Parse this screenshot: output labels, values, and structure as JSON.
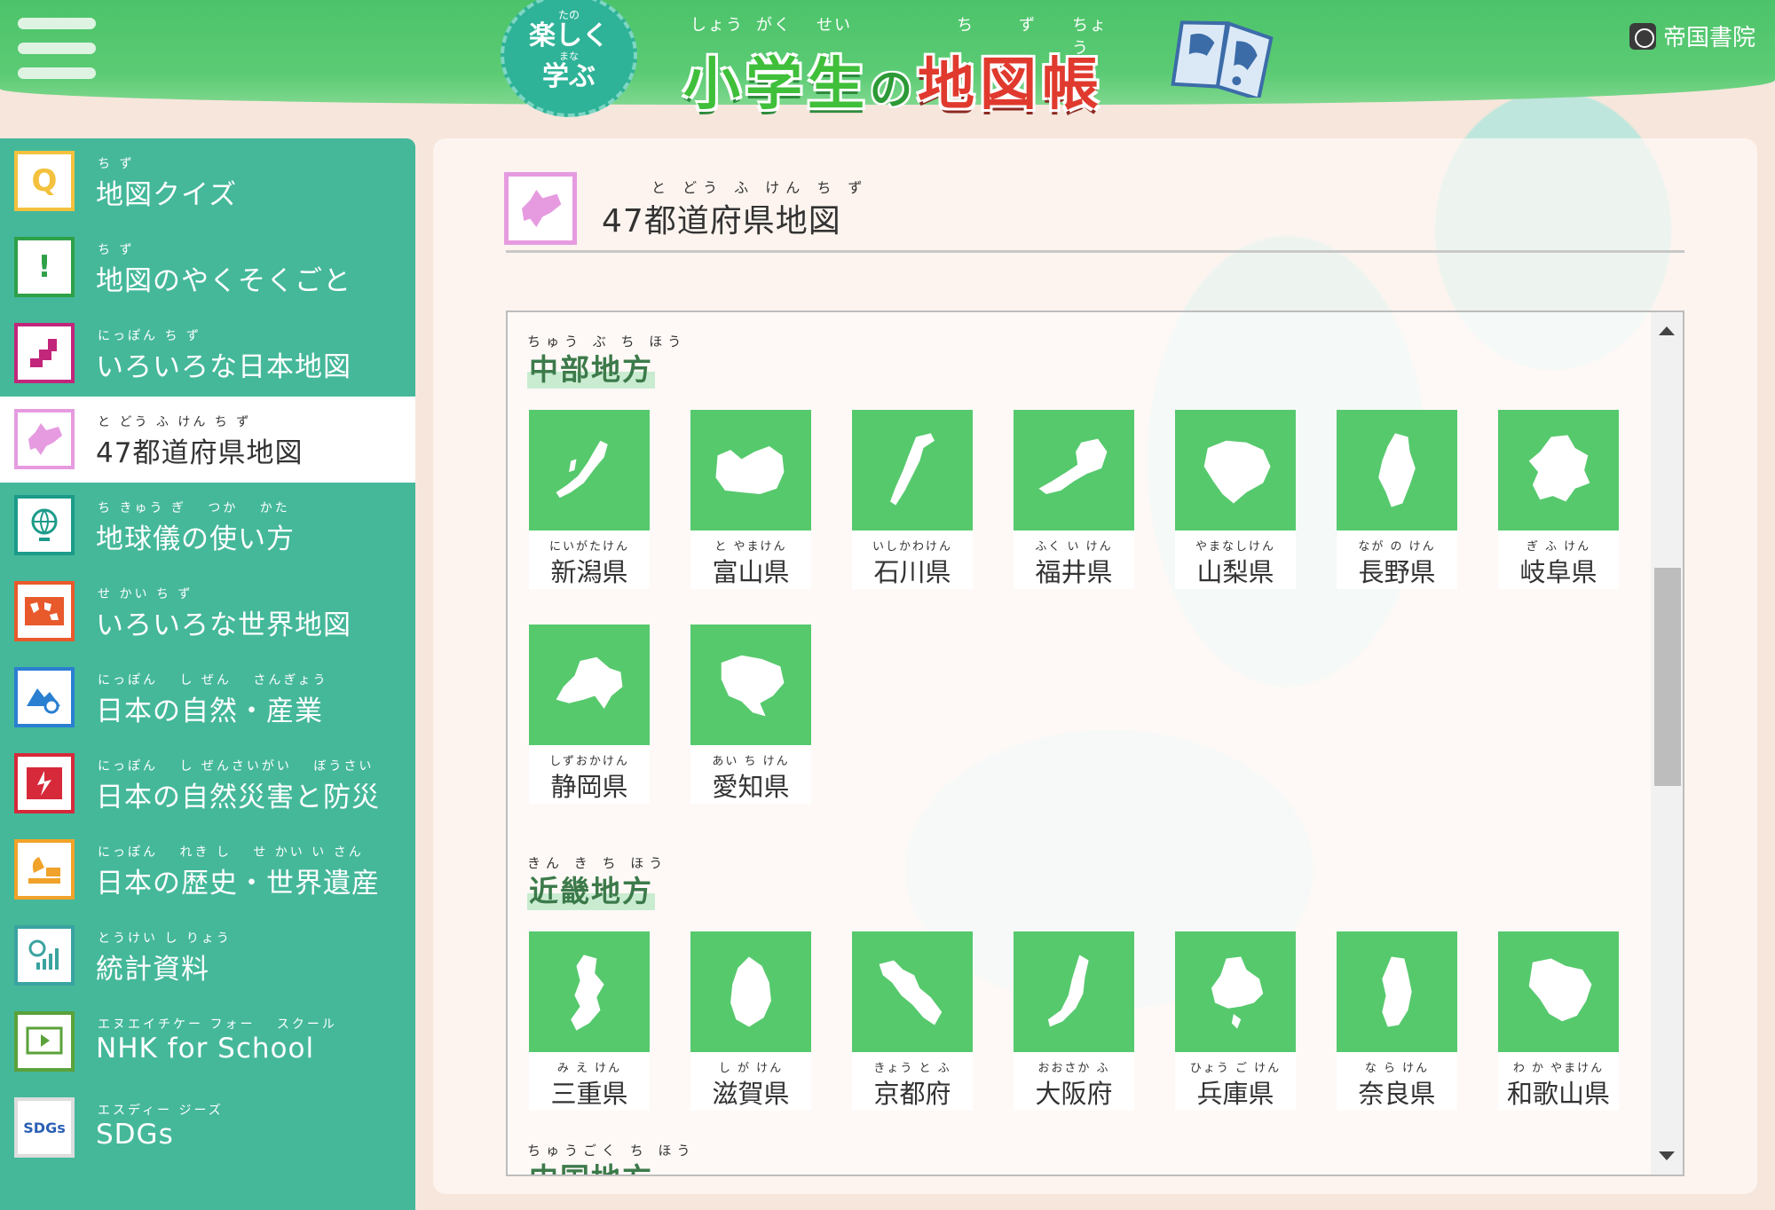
{
  "header": {
    "badge": {
      "ruby_top": "たの",
      "line1": "楽しく",
      "ruby_mid": "まな",
      "line2": "学ぶ"
    },
    "title": {
      "part1": "小学生",
      "part2": "の",
      "part3": "地図帳",
      "ruby": [
        "しょう",
        "がく",
        "せい",
        "ち",
        "ず",
        "ちょう"
      ]
    },
    "publisher": "帝国書院"
  },
  "sidebar": {
    "items": [
      {
        "icon": "Q",
        "icon_color": "#f3c13d",
        "ruby": "ち ず",
        "label": "地図クイズ",
        "active": false
      },
      {
        "icon": "!",
        "icon_color": "#2da048",
        "ruby": "ち ず",
        "label": "地図のやくそくごと",
        "active": false
      },
      {
        "icon": "",
        "icon_color": "#c2267a",
        "ruby": "にっぽん ち ず",
        "label": "いろいろな日本地図",
        "active": false
      },
      {
        "icon": "",
        "icon_color": "#e69be0",
        "ruby": "と どう ふ けん ち ず",
        "label": "47都道府県地図",
        "active": true
      },
      {
        "icon": "",
        "icon_color": "#1c9b8a",
        "ruby": "ち きゅう ぎ　 つか　 かた",
        "label": "地球儀の使い方",
        "active": false
      },
      {
        "icon": "",
        "icon_color": "#e8592b",
        "ruby": "せ かい ち ず",
        "label": "いろいろな世界地図",
        "active": false
      },
      {
        "icon": "",
        "icon_color": "#2a7fd1",
        "ruby": "にっぽん　 し ぜん　 さんぎょう",
        "label": "日本の自然・産業",
        "active": false
      },
      {
        "icon": "",
        "icon_color": "#d6293a",
        "ruby": "にっぽん　 し ぜんさいがい　 ぼうさい",
        "label": "日本の自然災害と防災",
        "active": false
      },
      {
        "icon": "",
        "icon_color": "#f0a22a",
        "ruby": "にっぽん　 れき し　 せ かい い さん",
        "label": "日本の歴史・世界遺産",
        "active": false
      },
      {
        "icon": "",
        "icon_color": "#3aa3a0",
        "ruby": "とうけい し りょう",
        "label": "統計資料",
        "active": false
      },
      {
        "icon": "",
        "icon_color": "#5aa23a",
        "ruby": "エヌエイチケー フォー　 スクール",
        "label": "NHK for School",
        "active": false
      },
      {
        "icon": "SDGs",
        "icon_color": "#2b5fb5",
        "ruby": "エスディー ジーズ",
        "label": "SDGs",
        "active": false
      }
    ]
  },
  "main": {
    "heading_ruby": "と どう ふ けん ち ず",
    "heading": "47都道府県地図",
    "regions": [
      {
        "ruby": "ちゅう ぶ ち ほう",
        "title": "中部地方",
        "prefectures": [
          {
            "ruby": "にいがたけん",
            "name": "新潟県"
          },
          {
            "ruby": "と やまけん",
            "name": "富山県"
          },
          {
            "ruby": "いしかわけん",
            "name": "石川県"
          },
          {
            "ruby": "ふく い けん",
            "name": "福井県"
          },
          {
            "ruby": "やまなしけん",
            "name": "山梨県"
          },
          {
            "ruby": "なが の けん",
            "name": "長野県"
          },
          {
            "ruby": "ぎ ふ けん",
            "name": "岐阜県"
          },
          {
            "ruby": "しずおかけん",
            "name": "静岡県"
          },
          {
            "ruby": "あい ち けん",
            "name": "愛知県"
          }
        ]
      },
      {
        "ruby": "きん き ち ほう",
        "title": "近畿地方",
        "prefectures": [
          {
            "ruby": "み え けん",
            "name": "三重県"
          },
          {
            "ruby": "し が けん",
            "name": "滋賀県"
          },
          {
            "ruby": "きょう と ふ",
            "name": "京都府"
          },
          {
            "ruby": "おおさか ふ",
            "name": "大阪府"
          },
          {
            "ruby": "ひょう ご けん",
            "name": "兵庫県"
          },
          {
            "ruby": "な ら けん",
            "name": "奈良県"
          },
          {
            "ruby": "わ か やまけん",
            "name": "和歌山県"
          }
        ]
      },
      {
        "ruby": "ちゅうごく ち ほう",
        "title": "中国地方",
        "prefectures": []
      }
    ]
  },
  "colors": {
    "header_green": "#4cc36a",
    "sidebar_teal": "#45b89a",
    "tile_green": "#56c96d",
    "title_red": "#e03a2e"
  }
}
